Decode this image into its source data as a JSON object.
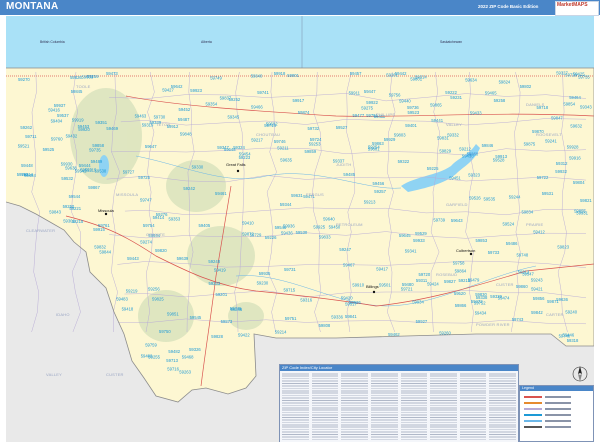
{
  "header": {
    "title": "MONTANA",
    "edition": "2022 ZIP Code Basic Edition",
    "logo_text": "MarketMAPS"
  },
  "map": {
    "colors": {
      "state_fill": "#fdf7d2",
      "surround_fill": "#e9e9e9",
      "canada_water": "#a9e1f7",
      "lake": "#8fd3f3",
      "county_line": "#b7a9d6",
      "zip_label": "#1d9ad6",
      "highway": "#d9534f",
      "border": "#8c8c8c",
      "relief": "#c7d9b3"
    },
    "provinces": [
      "British Columbia",
      "Alberta",
      "Saskatchewan"
    ],
    "cities": [
      "Great Falls",
      "Missoula",
      "Billings",
      "Culbertson"
    ],
    "counties": [
      "TOOLE",
      "TETON",
      "CHOUTEAU",
      "GARFIELD",
      "PETROLEUM",
      "ROSEBUD",
      "CUSTER",
      "POWDER RIVER",
      "MISSOULA",
      "GRANITE",
      "PHILLIPS",
      "VALLEY",
      "DANIELS",
      "ROOSEVELT",
      "PRAIRIE",
      "CARTER",
      "FERGUS",
      "JUDITH",
      "CLEARWATER",
      "IDAHO",
      "VALLEY",
      "CUSTER"
    ],
    "zip_codes": [
      "59917",
      "59918",
      "59922",
      "59930",
      "59935",
      "59446",
      "59473",
      "59474",
      "59448",
      "59447",
      "59456",
      "59468",
      "59477",
      "59480",
      "59521",
      "59522",
      "59525",
      "59530",
      "59532",
      "59537",
      "59538",
      "59542",
      "59544",
      "59545",
      "59546",
      "59547",
      "59201",
      "59211",
      "59212",
      "59213",
      "59214",
      "59215",
      "59217",
      "59218",
      "59219",
      "59221",
      "59222",
      "59223",
      "59225",
      "59226",
      "59230",
      "59231",
      "59240",
      "59241",
      "59242",
      "59243",
      "59244",
      "59245",
      "59247",
      "59248",
      "59250",
      "59252",
      "59253",
      "59254",
      "59255",
      "59256",
      "59257",
      "59258",
      "59259",
      "59260",
      "59261",
      "59262",
      "59263",
      "59270",
      "59274",
      "59275",
      "59276",
      "59301",
      "59311",
      "59312",
      "59313",
      "59314",
      "59315",
      "59316",
      "59317",
      "59318",
      "59319",
      "59322",
      "59323",
      "59324",
      "59326",
      "59327",
      "59330",
      "59332",
      "59333",
      "59336",
      "59337",
      "59338",
      "59339",
      "59341",
      "59343",
      "59344",
      "59345",
      "59347",
      "59349",
      "59351",
      "59353",
      "59354",
      "59401",
      "59404",
      "59405",
      "59410",
      "59411",
      "59412",
      "59414",
      "59416",
      "59417",
      "59418",
      "59419",
      "59420",
      "59421",
      "59422",
      "59424",
      "59425",
      "59427",
      "59430",
      "59432",
      "59433",
      "59434",
      "59436",
      "59440",
      "59441",
      "59442",
      "59443",
      "59444",
      "59450",
      "59451",
      "59452",
      "59453",
      "59454",
      "59457",
      "59460",
      "59461",
      "59462",
      "59463",
      "59464",
      "59465",
      "59466",
      "59467",
      "59469",
      "59471",
      "59472",
      "59479",
      "59482",
      "59483",
      "59484",
      "59485",
      "59486",
      "59487",
      "59489",
      "59501",
      "59520",
      "59523",
      "59524",
      "59526",
      "59527",
      "59528",
      "59529",
      "59531",
      "59535",
      "59601",
      "59602",
      "59631",
      "59632",
      "59633",
      "59634",
      "59635",
      "59636",
      "59638",
      "59639",
      "59640",
      "59642",
      "59643",
      "59644",
      "59645",
      "59647",
      "59648",
      "59701",
      "59711",
      "59713",
      "59714",
      "59715",
      "59716",
      "59718",
      "59720",
      "59721",
      "59722",
      "59724",
      "59725",
      "59727",
      "59728",
      "59729",
      "59730",
      "59731",
      "59732",
      "59733",
      "59735",
      "59736",
      "59739",
      "59740",
      "59741",
      "59743",
      "59745",
      "59746",
      "59747",
      "59748",
      "59749",
      "59750",
      "59751",
      "59752",
      "59754",
      "59755",
      "59756",
      "59758",
      "59759",
      "59760",
      "59761",
      "59762",
      "59801",
      "59802",
      "59803",
      "59804",
      "59808",
      "59820",
      "59821",
      "59823",
      "59824",
      "59825",
      "59826",
      "59827",
      "59828",
      "59829",
      "59830",
      "59831",
      "59832",
      "59833",
      "59834",
      "59837",
      "59840",
      "59841",
      "59842",
      "59843",
      "59844",
      "59845",
      "59846",
      "59847",
      "59848",
      "59851",
      "59853",
      "59854",
      "59855",
      "59856",
      "59858",
      "59859",
      "59860",
      "59863",
      "59864",
      "59865",
      "59866",
      "59867",
      "59868",
      "59870",
      "59871",
      "59872",
      "59873",
      "59874",
      "59875",
      "59901",
      "59910",
      "59911",
      "59912",
      "59913",
      "59914",
      "59915",
      "59916",
      "59919",
      "59920",
      "59923",
      "59925",
      "59926",
      "59927",
      "59928",
      "59929",
      "59931",
      "59932",
      "59933",
      "59934",
      "59936",
      "59937"
    ]
  },
  "index_panel": {
    "title": "ZIP Code Index/City Locator"
  },
  "legend": {
    "title": "Legend"
  }
}
